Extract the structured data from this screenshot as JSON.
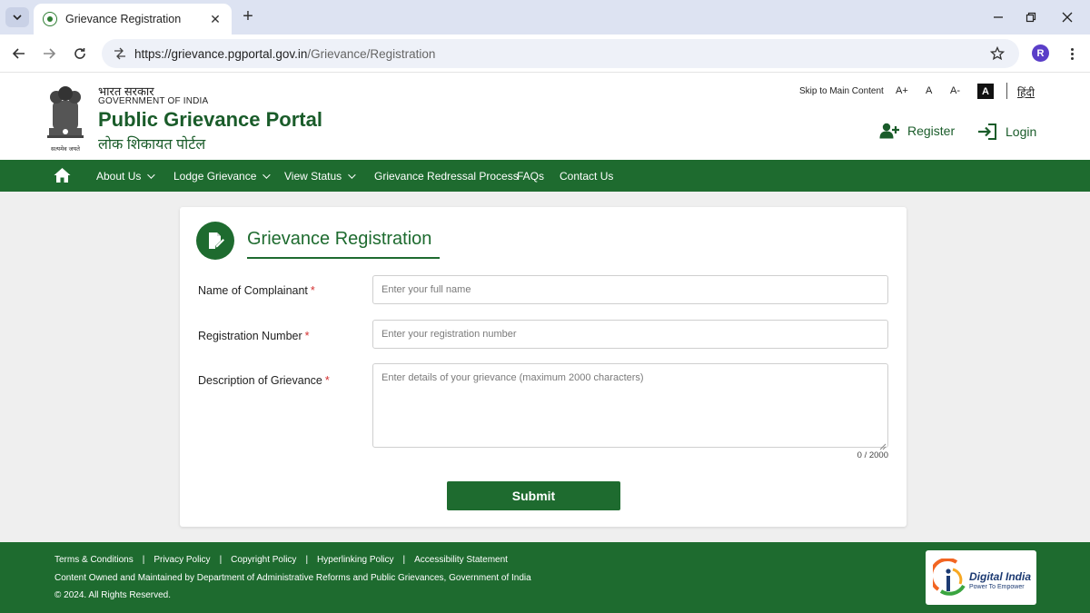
{
  "browser": {
    "tab_title": "Grievance Registration",
    "url_domain": "https://grievance.pgportal.gov.in",
    "url_path": "/Grievance/Registration",
    "profile_initial": "R"
  },
  "header": {
    "gov_hindi": "भारत सरकार",
    "gov_english": "GOVERNMENT OF INDIA",
    "portal_title": "Public Grievance Portal",
    "portal_hindi": "लोक शिकायत पोर्टल",
    "emblem_motto": "सत्यमेव जयते",
    "skip_link": "Skip to Main Content",
    "font_increase": "A+",
    "font_normal": "A",
    "font_decrease": "A-",
    "contrast_label": "A",
    "language": "हिंदी",
    "register_label": "Register",
    "login_label": "Login"
  },
  "nav": {
    "items": [
      {
        "label": "About Us",
        "dropdown": true
      },
      {
        "label": "Lodge Grievance",
        "dropdown": true
      },
      {
        "label": "View Status",
        "dropdown": true
      },
      {
        "label": "Grievance Redressal Process",
        "dropdown": false
      },
      {
        "label": "FAQs",
        "dropdown": false
      },
      {
        "label": "Contact Us",
        "dropdown": false
      }
    ]
  },
  "form": {
    "title": "Grievance Registration",
    "required_marker": "*",
    "name_label": "Name of Complainant",
    "name_placeholder": "Enter your full name",
    "reg_label": "Registration Number",
    "reg_placeholder": "Enter your registration number",
    "desc_label": "Description of Grievance",
    "desc_placeholder": "Enter details of your grievance (maximum 2000 characters)",
    "char_count": "0 / 2000",
    "submit_label": "Submit"
  },
  "footer": {
    "links": [
      "Terms & Conditions",
      "Privacy Policy",
      "Copyright Policy",
      "Hyperlinking Policy",
      "Accessibility Statement"
    ],
    "separator": "|",
    "owner": "Content Owned and Maintained by Department of Administrative Reforms and Public Grievances, Government of India",
    "copyright": "© 2024. All Rights Reserved.",
    "logo_title": "Digital India",
    "logo_tagline": "Power To Empower"
  },
  "colors": {
    "brand_green": "#1e6b2f",
    "required_red": "#d32f2f",
    "page_bg": "#efefef"
  }
}
